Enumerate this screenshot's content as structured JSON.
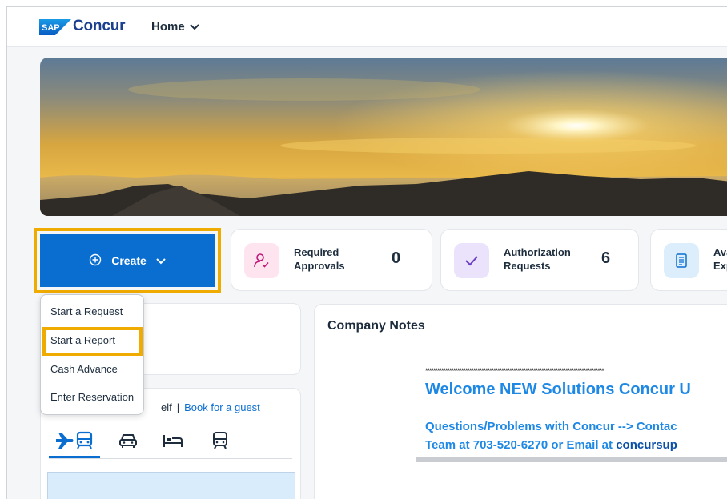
{
  "brand": {
    "sap": "SAP",
    "name": "Concur"
  },
  "nav": {
    "home_label": "Home"
  },
  "create": {
    "label": "Create"
  },
  "create_menu": {
    "items": [
      "Start a Request",
      "Start a Report",
      "Cash Advance",
      "Enter Reservation"
    ]
  },
  "tiles": [
    {
      "line1": "Required",
      "line2": "Approvals",
      "count": "0",
      "icon": "person-check-icon",
      "color": "#fde4ee"
    },
    {
      "line1": "Authorization",
      "line2": "Requests",
      "count": "6",
      "icon": "checkmark-icon",
      "color": "#ebe3fb"
    },
    {
      "line1": "Ava",
      "line2": "Exp",
      "count": "",
      "icon": "receipt-icon",
      "color": "#dcedfb"
    }
  ],
  "company_notes": {
    "title": "Company Notes",
    "stars": "*****************************************************************************************",
    "welcome": "Welcome NEW Solutions Concur U",
    "line1": "Questions/Problems with Concur --> Contac",
    "line2_prefix": "Team at 703-520-6270 or Email at ",
    "line2_email": "concursup"
  },
  "booking": {
    "self_text": "elf",
    "separator": "|",
    "guest_link": "Book for a guest",
    "tabs": [
      "flight-train-icon",
      "car-icon",
      "hotel-icon",
      "rail-icon"
    ]
  },
  "colors": {
    "accent": "#0a6ed1",
    "highlight": "#f0ab00",
    "link_blue": "#1e88e5"
  }
}
